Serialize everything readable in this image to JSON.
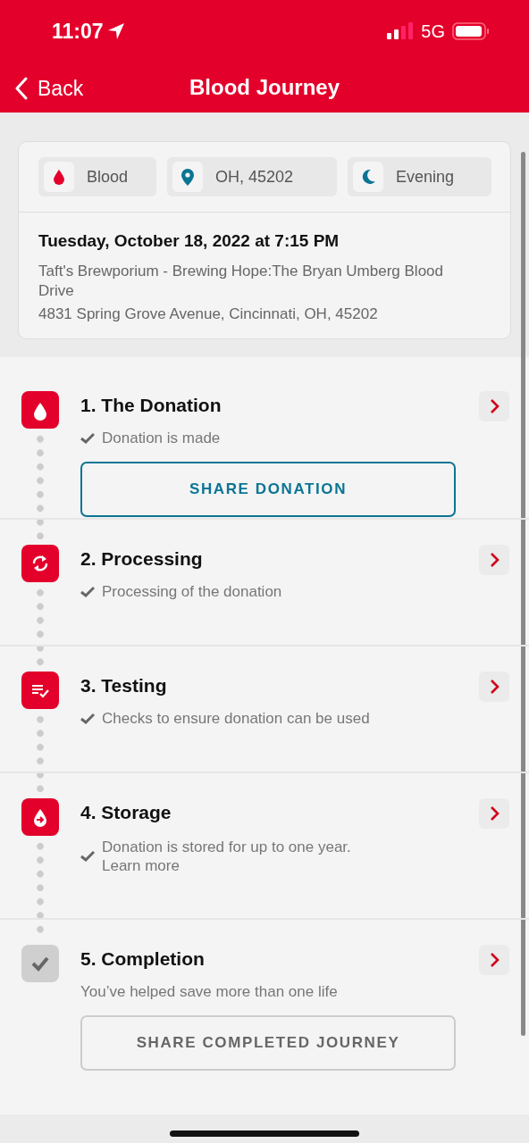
{
  "status_bar": {
    "time": "11:07",
    "network": "5G"
  },
  "nav": {
    "back": "Back",
    "title": "Blood Journey"
  },
  "summary": {
    "chips": [
      {
        "kind": "drop",
        "label": "Blood"
      },
      {
        "kind": "pin",
        "label": "OH, 45202"
      },
      {
        "kind": "moon",
        "label": "Evening"
      }
    ],
    "date": "Tuesday, October 18, 2022 at 7:15 PM",
    "venue": "Taft's Brewporium - Brewing Hope:The Bryan Umberg Blood Drive",
    "address": "4831 Spring Grove Avenue, Cincinnati, OH, 45202"
  },
  "steps": [
    {
      "kind": "drop",
      "title": "1. The Donation",
      "status": "Donation is made",
      "completed": true,
      "button": {
        "label": "SHARE DONATION",
        "enabled": true
      }
    },
    {
      "kind": "sync",
      "title": "2. Processing",
      "status": "Processing of the donation",
      "completed": true
    },
    {
      "kind": "checklist",
      "title": "3. Testing",
      "status": "Checks to ensure donation can be used",
      "completed": true
    },
    {
      "kind": "storage",
      "title": "4. Storage",
      "status": "Donation is stored for up to one year.",
      "link": "Learn more",
      "completed": true
    },
    {
      "kind": "check",
      "title": "5. Completion",
      "status": "You’ve helped save more than one life",
      "completed": false,
      "button": {
        "label": "SHARE COMPLETED JOURNEY",
        "enabled": false
      }
    }
  ]
}
